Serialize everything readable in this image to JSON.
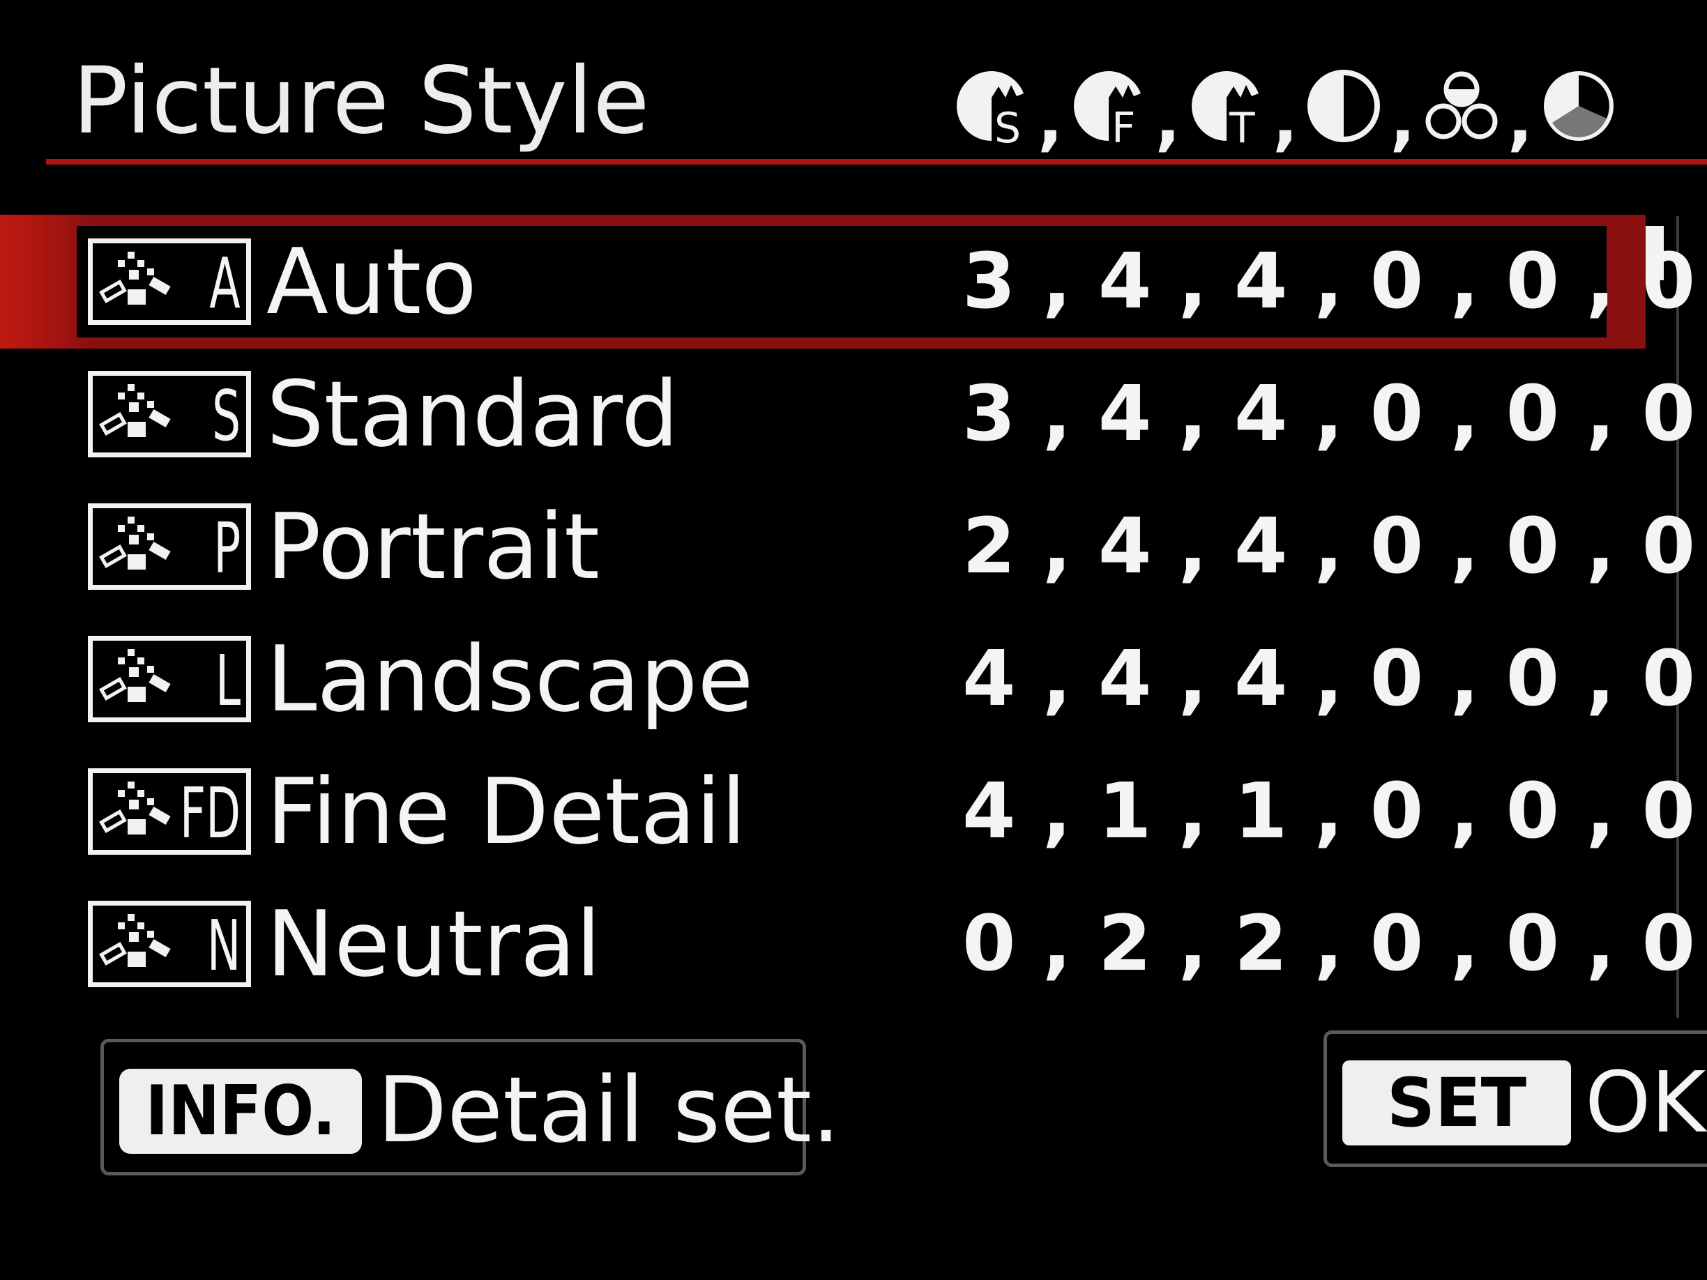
{
  "header": {
    "title": "Picture Style",
    "param_icons": [
      {
        "icon": "sharpness-strength-icon",
        "letter": "S"
      },
      {
        "icon": "sharpness-fineness-icon",
        "letter": "F"
      },
      {
        "icon": "sharpness-threshold-icon",
        "letter": "T"
      },
      {
        "icon": "contrast-icon",
        "letter": ""
      },
      {
        "icon": "saturation-icon",
        "letter": ""
      },
      {
        "icon": "color-tone-icon",
        "letter": ""
      }
    ],
    "separator": ","
  },
  "styles": [
    {
      "code": "A",
      "name": "Auto",
      "values": "3 , 4 , 4 , 0 , 0 , 0",
      "selected": true
    },
    {
      "code": "S",
      "name": "Standard",
      "values": "3 , 4 , 4 , 0 , 0 , 0",
      "selected": false
    },
    {
      "code": "P",
      "name": "Portrait",
      "values": "2 , 4 , 4 , 0 , 0 , 0",
      "selected": false
    },
    {
      "code": "L",
      "name": "Landscape",
      "values": "4 , 4 , 4 , 0 , 0 , 0",
      "selected": false
    },
    {
      "code": "FD",
      "name": "Fine Detail",
      "values": "4 , 1 , 1 , 0 , 0 , 0",
      "selected": false
    },
    {
      "code": "N",
      "name": "Neutral",
      "values": "0 , 2 , 2 , 0 , 0 , 0",
      "selected": false
    }
  ],
  "footer": {
    "info_key": "INFO.",
    "info_label": "Detail set.",
    "set_key": "SET",
    "set_label": "OK"
  },
  "colors": {
    "background": "#000000",
    "accent": "#b01313",
    "text": "#f4f4f4"
  }
}
